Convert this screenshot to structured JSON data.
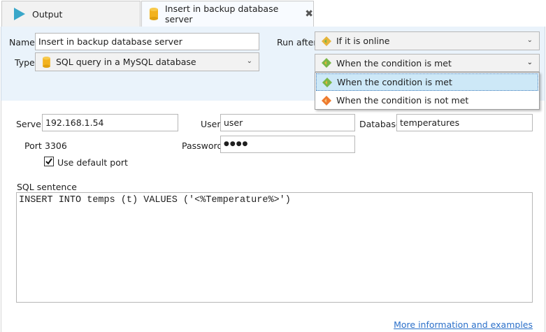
{
  "tabs": [
    {
      "label": "Output",
      "icon": "play-triangle-icon"
    },
    {
      "label": "Insert in backup database server",
      "icon": "database-cylinder-icon",
      "close_glyph": "✖"
    }
  ],
  "form": {
    "name_label": "Name",
    "name_value": "Insert in backup database server",
    "type_label": "Type",
    "type_value": "SQL query in a MySQL database",
    "run_after_label": "Run after",
    "run_after_value": "If it is online",
    "condition_value": "When the condition is met"
  },
  "dropdown_options": [
    {
      "label": "When the condition is met",
      "icon": "green-diamond-icon",
      "selected": true
    },
    {
      "label": "When the condition is not met",
      "icon": "orange-diamond-icon",
      "selected": false
    }
  ],
  "connection": {
    "server_label": "Server",
    "server_value": "192.168.1.54",
    "user_label": "User",
    "user_value": "user",
    "database_label": "Database",
    "database_value": "temperatures",
    "port_label": "Port",
    "port_value": "3306",
    "password_label": "Password",
    "password_value": "●●●●",
    "default_port_label": "Use default port",
    "default_port_checked": true
  },
  "sql": {
    "label": "SQL sentence",
    "value": "INSERT INTO temps (t) VALUES ('<%Temperature%>')"
  },
  "footer": {
    "link": "More information and examples"
  },
  "colors": {
    "panel_bg": "#eaf3fb",
    "selected_item_bg": "#cde8f7",
    "link": "#2a6fc9",
    "play_icon": "#3aa7c9",
    "db_icon": "#f2b21e",
    "green_diamond": "#7ab648",
    "orange_diamond": "#ee7a2f"
  }
}
